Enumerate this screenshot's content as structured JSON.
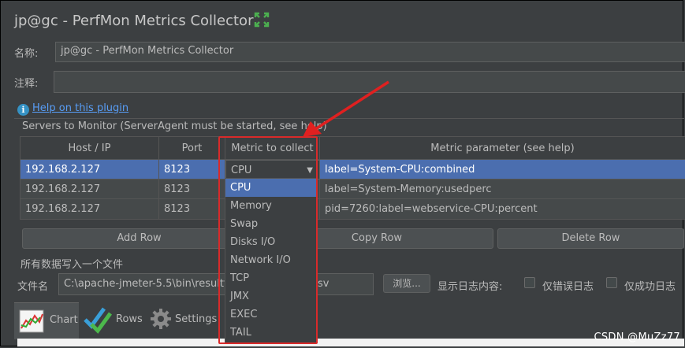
{
  "window": {
    "title": "jp@gc - PerfMon Metrics Collector"
  },
  "form": {
    "name_label": "名称:",
    "name_value": "jp@gc - PerfMon Metrics Collector",
    "comment_label": "注释:",
    "comment_value": ""
  },
  "help": {
    "link": "Help on this plugin"
  },
  "servers": {
    "section_label": "Servers to Monitor (ServerAgent must be started, see help)",
    "columns": [
      "Host / IP",
      "Port",
      "Metric to collect",
      "Metric parameter (see help)"
    ],
    "rows": [
      {
        "host": "192.168.2.127",
        "port": "8123",
        "metric": "CPU",
        "param": "label=System-CPU:combined"
      },
      {
        "host": "192.168.2.127",
        "port": "8123",
        "metric": "",
        "param": "label=System-Memory:usedperc"
      },
      {
        "host": "192.168.2.127",
        "port": "8123",
        "metric": "",
        "param": "pid=7260:label=webservice-CPU:percent"
      }
    ]
  },
  "dropdown": {
    "selected": "CPU",
    "options": [
      "CPU",
      "Memory",
      "Swap",
      "Disks I/O",
      "Network I/O",
      "TCP",
      "JMX",
      "EXEC",
      "TAIL"
    ]
  },
  "buttons": {
    "add_row": "Add Row",
    "copy_row": "Copy Row",
    "delete_row": "Delete Row"
  },
  "file": {
    "section_label": "所有数据写入一个文件",
    "filename_label": "文件名",
    "filename_value": "C:\\apache-jmeter-5.5\\bin\\resultfil",
    "filename_tail": "sv",
    "browse_label": "浏览...",
    "log_label": "显示日志内容:",
    "errors_only_label": "仅错误日志",
    "success_only_label": "仅成功日志"
  },
  "tabs": [
    {
      "label": "Chart",
      "icon": "chart-icon"
    },
    {
      "label": "Rows",
      "icon": "checkmarks-icon"
    },
    {
      "label": "Settings",
      "icon": "gear-icon"
    }
  ],
  "watermark": "CSDN @MuZz77",
  "colors": {
    "selection": "#4b6eaf",
    "link": "#589df6",
    "annotation": "#d92a2a",
    "background": "#3c3f41"
  }
}
